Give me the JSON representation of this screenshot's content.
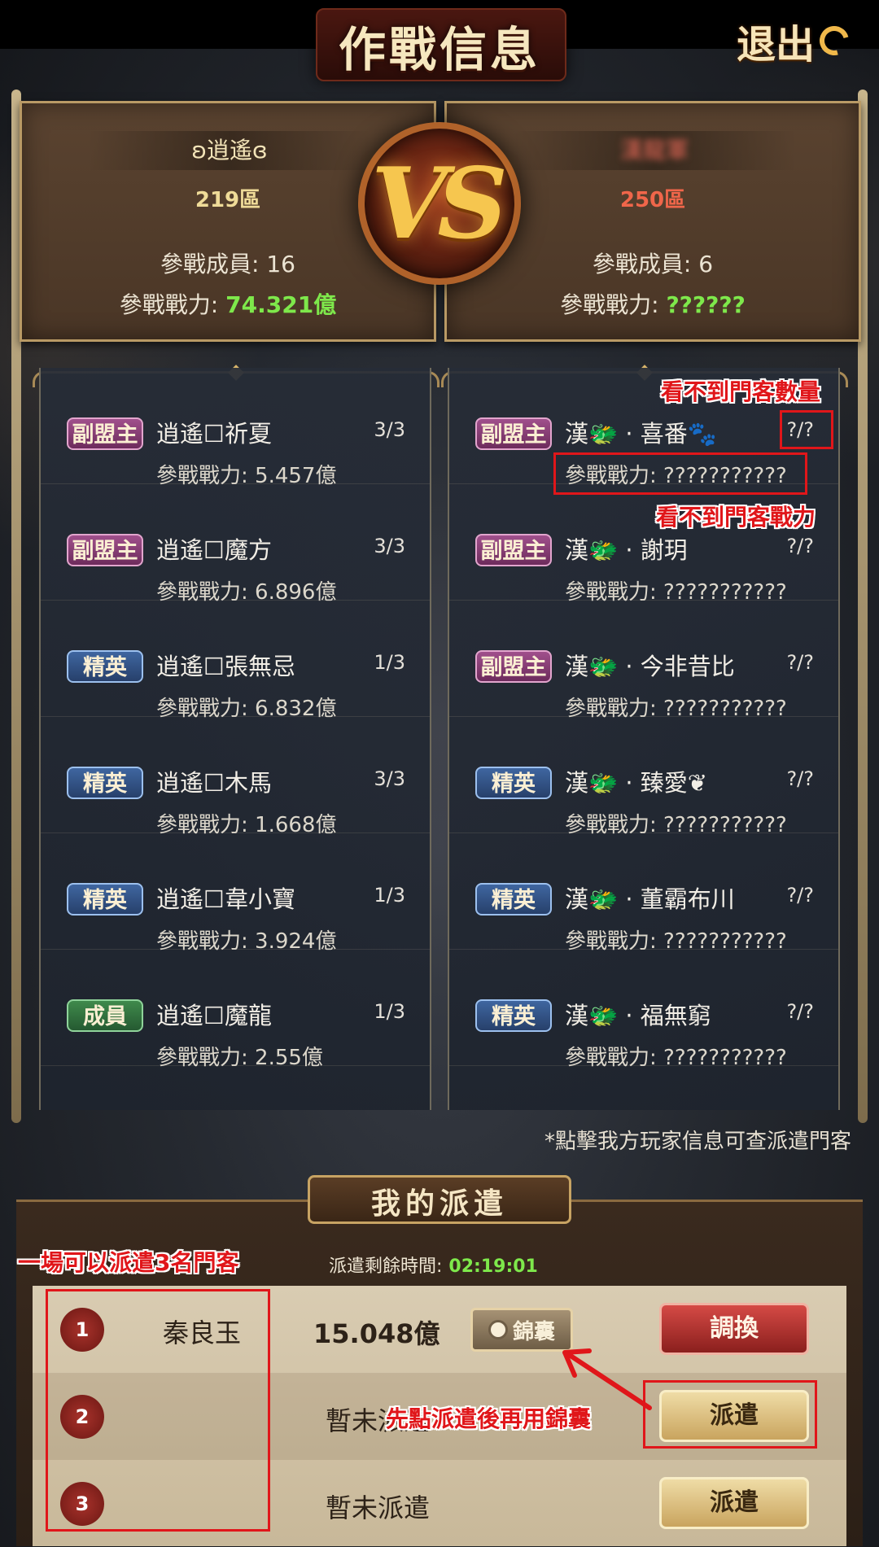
{
  "header": {
    "title": "作戰信息",
    "exit_label": "退出"
  },
  "teams": {
    "left": {
      "name": "ʚ逍遙ɞ",
      "server": "219區",
      "members_label": "參戰成員:",
      "members_value": "16",
      "power_label": "參戰戰力:",
      "power_value": "74.321億"
    },
    "right": {
      "name": "漢龍軍",
      "server": "250區",
      "members_label": "參戰成員:",
      "members_value": "6",
      "power_label": "參戰戰力:",
      "power_value": "??????"
    },
    "vs_label": "VS"
  },
  "roster_left": [
    {
      "rank": "副盟主",
      "rank_type": "vice",
      "name": "逍遙☐祈夏",
      "count": "3/3",
      "power": "參戰戰力: 5.457億"
    },
    {
      "rank": "副盟主",
      "rank_type": "vice",
      "name": "逍遙☐魔方",
      "count": "3/3",
      "power": "參戰戰力: 6.896億"
    },
    {
      "rank": "精英",
      "rank_type": "elite",
      "name": "逍遙☐張無忌",
      "count": "1/3",
      "power": "參戰戰力: 6.832億"
    },
    {
      "rank": "精英",
      "rank_type": "elite",
      "name": "逍遙☐木馬",
      "count": "3/3",
      "power": "參戰戰力: 1.668億"
    },
    {
      "rank": "精英",
      "rank_type": "elite",
      "name": "逍遙☐韋小寶",
      "count": "1/3",
      "power": "參戰戰力: 3.924億"
    },
    {
      "rank": "成員",
      "rank_type": "member",
      "name": "逍遙☐魔龍",
      "count": "1/3",
      "power": "參戰戰力: 2.55億"
    }
  ],
  "roster_right": [
    {
      "rank": "副盟主",
      "rank_type": "vice",
      "name": "漢🐲 · 喜番🐾",
      "count": "?/?",
      "power": "參戰戰力: ???????????"
    },
    {
      "rank": "副盟主",
      "rank_type": "vice",
      "name": "漢🐲 · 謝玥",
      "count": "?/?",
      "power": "參戰戰力: ???????????"
    },
    {
      "rank": "副盟主",
      "rank_type": "vice",
      "name": "漢🐲 · 今非昔比",
      "count": "?/?",
      "power": "參戰戰力: ???????????"
    },
    {
      "rank": "精英",
      "rank_type": "elite",
      "name": "漢🐲 · 臻愛❦",
      "count": "?/?",
      "power": "參戰戰力: ???????????"
    },
    {
      "rank": "精英",
      "rank_type": "elite",
      "name": "漢🐲 · 董霸布川",
      "count": "?/?",
      "power": "參戰戰力: ???????????"
    },
    {
      "rank": "精英",
      "rank_type": "elite",
      "name": "漢🐲 · 福無窮",
      "count": "?/?",
      "power": "參戰戰力: ???????????"
    }
  ],
  "note": "*點擊我方玩家信息可查派遣門客",
  "dispatch": {
    "title": "我的派遣",
    "remaining_label": "派遣剩餘時間:",
    "remaining_time": "02:19:01",
    "slots": [
      {
        "num": "1",
        "hero": "秦良玉",
        "power": "15.048億",
        "kit_label": "錦囊",
        "action": "調換"
      },
      {
        "num": "2",
        "status": "暫未派遣",
        "action": "派遣"
      },
      {
        "num": "3",
        "status": "暫未派遣",
        "action": "派遣"
      }
    ]
  },
  "annotations": {
    "count_hidden": "看不到門客數量",
    "power_hidden": "看不到門客戰力",
    "max_three": "一場可以派遣3名門客",
    "use_kit_after": "先點派遣後再用錦囊"
  },
  "colors": {
    "accent_green": "#7ee84b",
    "enemy_red": "#f0664a",
    "annotation_red": "#e0161a"
  }
}
